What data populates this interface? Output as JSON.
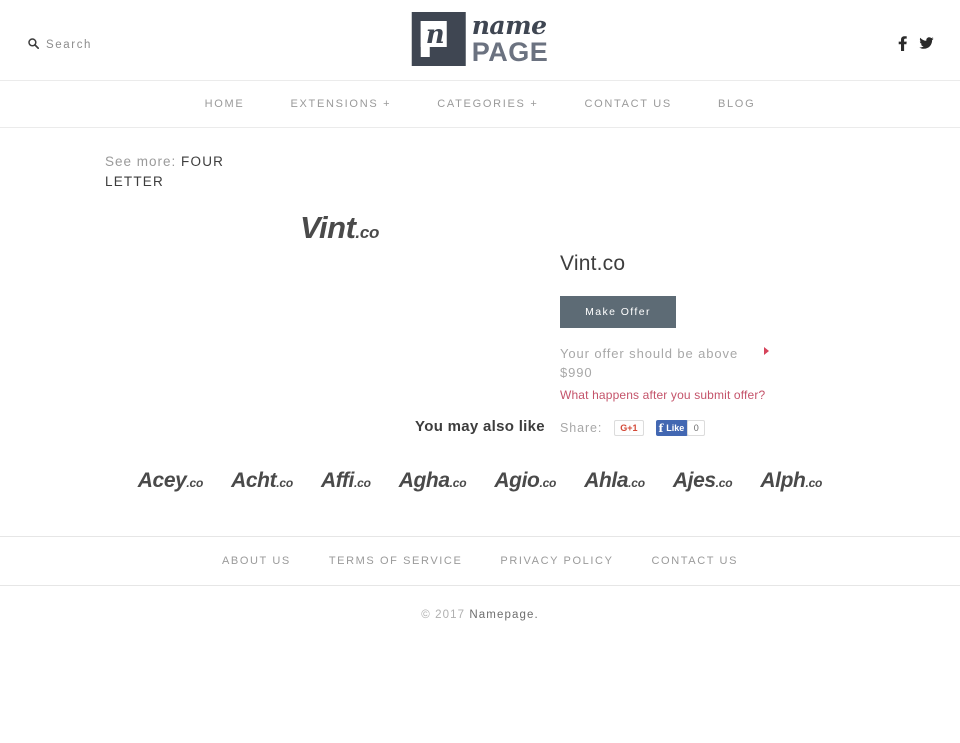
{
  "header": {
    "search": {
      "label": "Search",
      "icon": "search-icon"
    },
    "logo": {
      "mark_letter": "n",
      "name_text": "name",
      "page_text": "PAGE"
    },
    "social": [
      {
        "name": "facebook-icon",
        "label": "f"
      },
      {
        "name": "twitter-icon",
        "label": "t"
      }
    ]
  },
  "nav": {
    "items": [
      {
        "label": "HOME"
      },
      {
        "label": "EXTENSIONS +"
      },
      {
        "label": "CATEGORIES +"
      },
      {
        "label": "CONTACT US"
      },
      {
        "label": "BLOG"
      }
    ]
  },
  "breadcrumb": {
    "prefix": "See more:",
    "category": "FOUR LETTER"
  },
  "product": {
    "logo_name": "Vint",
    "logo_tld": ".co",
    "title": "Vint.co",
    "offer_button": "Make Offer",
    "offer_note": "Your offer should be above $990",
    "help_link": "What happens after you submit offer?",
    "share": {
      "label": "Share:",
      "gplus_label": "G+1",
      "facebook_f": "f",
      "facebook_label": "Like",
      "facebook_count": "0"
    }
  },
  "also_like": {
    "title": "You may also like",
    "items": [
      {
        "name": "Acey",
        "tld": ".co"
      },
      {
        "name": "Acht",
        "tld": ".co"
      },
      {
        "name": "Affi",
        "tld": ".co"
      },
      {
        "name": "Agha",
        "tld": ".co"
      },
      {
        "name": "Agio",
        "tld": ".co"
      },
      {
        "name": "Ahla",
        "tld": ".co"
      },
      {
        "name": "Ajes",
        "tld": ".co"
      },
      {
        "name": "Alph",
        "tld": ".co"
      }
    ]
  },
  "footer": {
    "links": [
      {
        "label": "ABOUT US"
      },
      {
        "label": "TERMS OF SERVICE"
      },
      {
        "label": "PRIVACY POLICY"
      },
      {
        "label": "CONTACT US"
      }
    ],
    "copyright_prefix": "© 2017 ",
    "copyright_brand": "Namepage."
  },
  "colors": {
    "button": "#5d6b75",
    "accent_red": "#c4536a",
    "marker_red": "#d6435b",
    "facebook_blue": "#4267b2",
    "gplus_red": "#d34836",
    "logo_dark": "#3f4652"
  }
}
